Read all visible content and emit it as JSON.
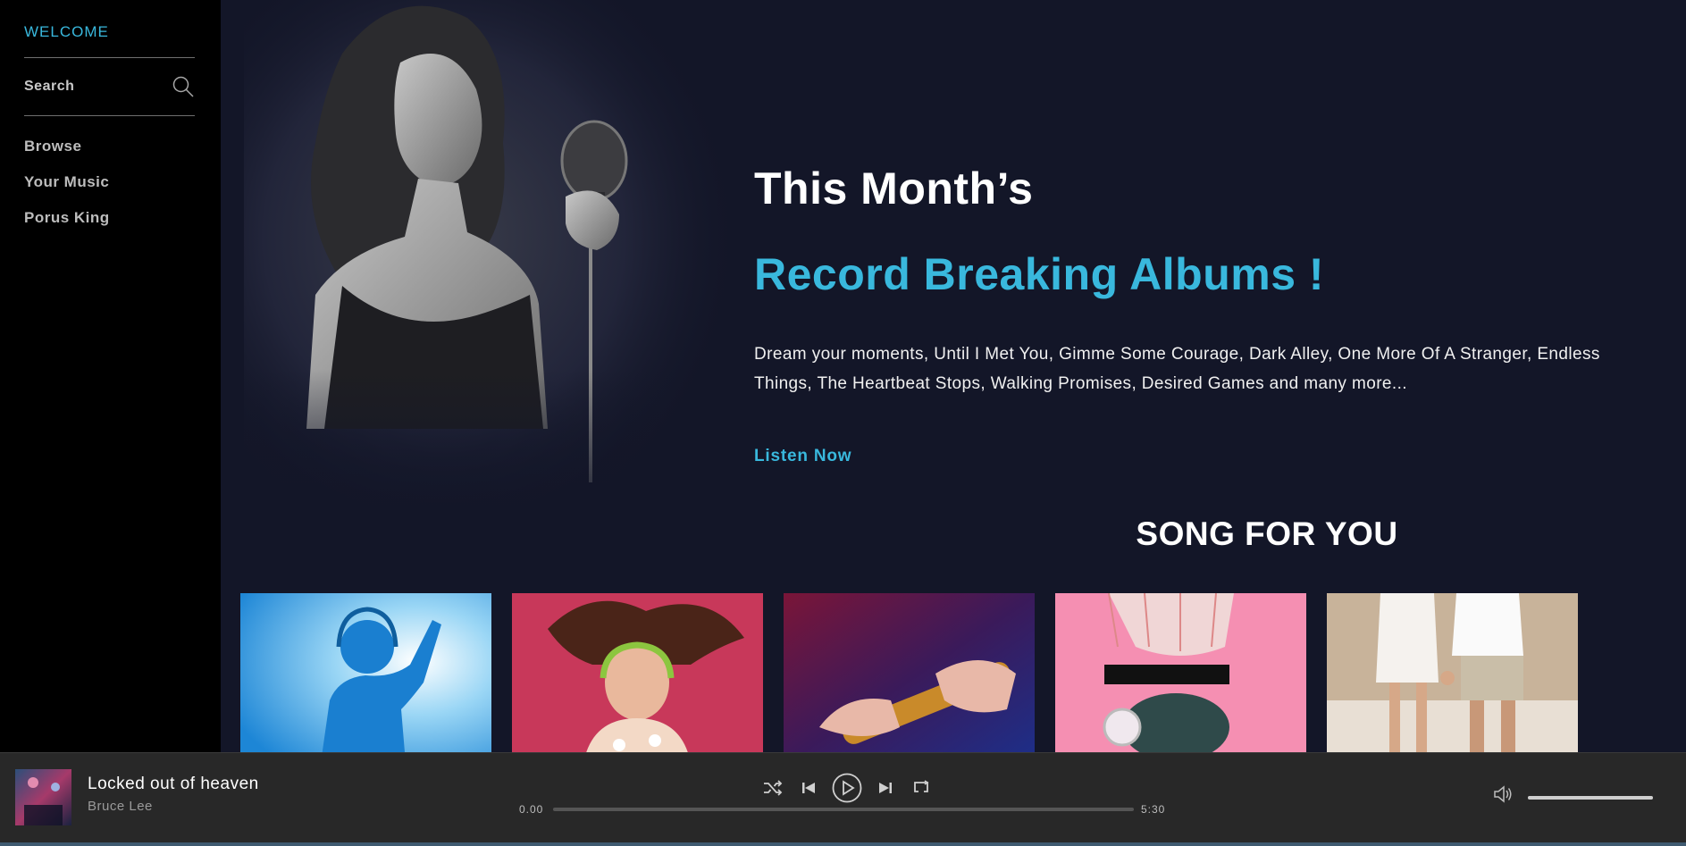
{
  "sidebar": {
    "welcome": "WELCOME",
    "search_label": "Search",
    "items": [
      {
        "label": "Browse"
      },
      {
        "label": "Your Music"
      },
      {
        "label": "Porus King"
      }
    ]
  },
  "hero": {
    "title": "This Month’s",
    "subtitle": "Record Breaking Albums !",
    "description": "Dream your moments, Until I Met You, Gimme Some Courage, Dark Alley, One More Of A Stranger, Endless Things, The Heartbeat Stops, Walking Promises, Desired Games and many more...",
    "cta": "Listen Now"
  },
  "songs_section": {
    "title": "SONG FOR YOU",
    "cards": [
      {
        "image": "dj-silhouette-blue"
      },
      {
        "image": "woman-headphones-red"
      },
      {
        "image": "hands-flute-purple"
      },
      {
        "image": "headphones-pink"
      },
      {
        "image": "couple-beach"
      }
    ]
  },
  "player": {
    "track_title": "Locked out of heaven",
    "artist": "Bruce Lee",
    "current_time": "0.00",
    "total_time": "5:30",
    "progress": 0,
    "volume": 1.0,
    "controls": [
      "shuffle-icon",
      "previous-icon",
      "play-icon",
      "next-icon",
      "repeat-icon"
    ]
  },
  "colors": {
    "accent": "#39b8dd",
    "main_bg": "#131628",
    "sidebar_bg": "#000000",
    "player_bg": "#282828"
  }
}
